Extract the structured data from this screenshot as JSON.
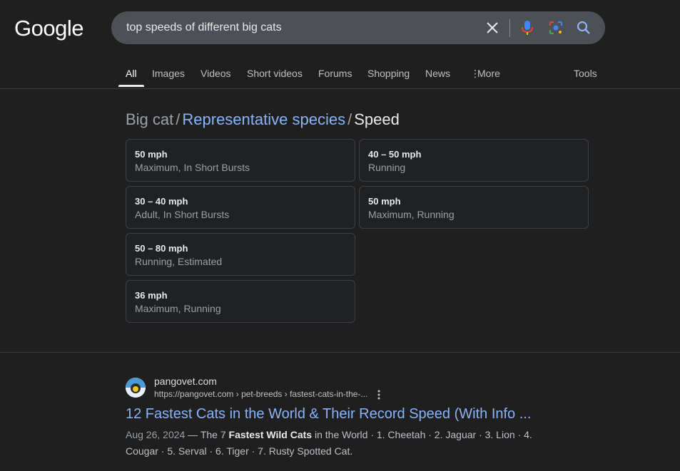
{
  "logo": "Google",
  "search": {
    "query": "top speeds of different big cats"
  },
  "tabs": [
    "All",
    "Images",
    "Videos",
    "Short videos",
    "Forums",
    "Shopping",
    "News",
    "More"
  ],
  "tools_label": "Tools",
  "breadcrumb": {
    "root": "Big cat",
    "parent": "Representative species",
    "current": "Speed",
    "sep": "/"
  },
  "speed_cards": [
    {
      "value": "50 mph",
      "desc": "Maximum, In Short Bursts"
    },
    {
      "value": "40 – 50 mph",
      "desc": "Running"
    },
    {
      "value": "30 – 40 mph",
      "desc": "Adult, In Short Bursts"
    },
    {
      "value": "50 mph",
      "desc": "Maximum, Running"
    },
    {
      "value": "50 – 80 mph",
      "desc": "Running, Estimated"
    },
    {
      "value": "36 mph",
      "desc": "Maximum, Running"
    }
  ],
  "result": {
    "site_name": "pangovet.com",
    "url": "https://pangovet.com › pet-breeds › fastest-cats-in-the-...",
    "title": "12 Fastest Cats in the World & Their Record Speed (With Info ...",
    "date": "Aug 26, 2024",
    "snippet_pre": " — The 7 ",
    "snippet_bold": "Fastest Wild Cats",
    "snippet_post": " in the World · 1. Cheetah · 2. Jaguar · 3. Lion · 4. Cougar · 5. Serval · 6. Tiger · 7. Rusty Spotted Cat."
  },
  "colors": {
    "background": "#1f1f1f",
    "link": "#8ab4f8",
    "search_bar": "#4d5156"
  }
}
